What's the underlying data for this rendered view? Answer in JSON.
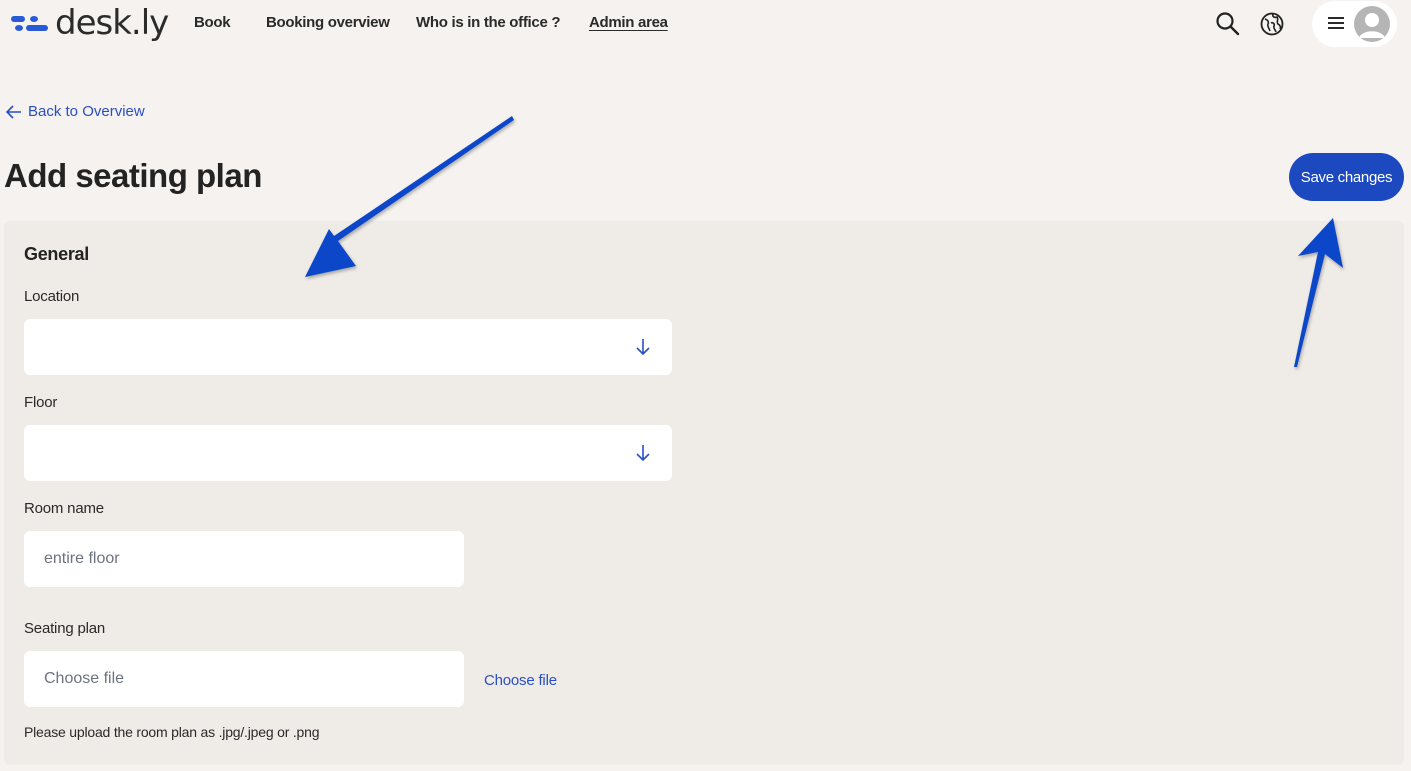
{
  "header": {
    "logo_text": "desk.ly",
    "nav": [
      {
        "label": "Book",
        "active": false
      },
      {
        "label": "Booking overview",
        "active": false
      },
      {
        "label": "Who is in the office ?",
        "active": false
      },
      {
        "label": "Admin area",
        "active": true
      }
    ],
    "icons": [
      "search-icon",
      "globe-icon",
      "menu-icon",
      "user-avatar-icon"
    ]
  },
  "back_link": {
    "label": "Back to Overview",
    "icon": "arrow-left-icon"
  },
  "page_title": "Add seating plan",
  "save_button": {
    "label": "Save changes"
  },
  "form": {
    "section_title": "General",
    "location": {
      "label": "Location",
      "value": "",
      "icon": "arrow-down-icon"
    },
    "floor": {
      "label": "Floor",
      "value": "",
      "icon": "arrow-down-icon"
    },
    "room_name": {
      "label": "Room name",
      "placeholder": "entire floor",
      "value": ""
    },
    "seating_plan": {
      "label": "Seating plan",
      "placeholder": "Choose file",
      "choose_file_link": "Choose file",
      "hint": "Please upload the room plan as .jpg/.jpeg or .png"
    }
  },
  "annotations": {
    "arrows": [
      "arrow-to-general-form",
      "arrow-to-save-button"
    ],
    "color": "#0a47c9"
  },
  "colors": {
    "accent": "#1c48c0",
    "link": "#2a4fc4",
    "page_bg": "#f5f2ef",
    "card_bg": "#efebe7"
  }
}
